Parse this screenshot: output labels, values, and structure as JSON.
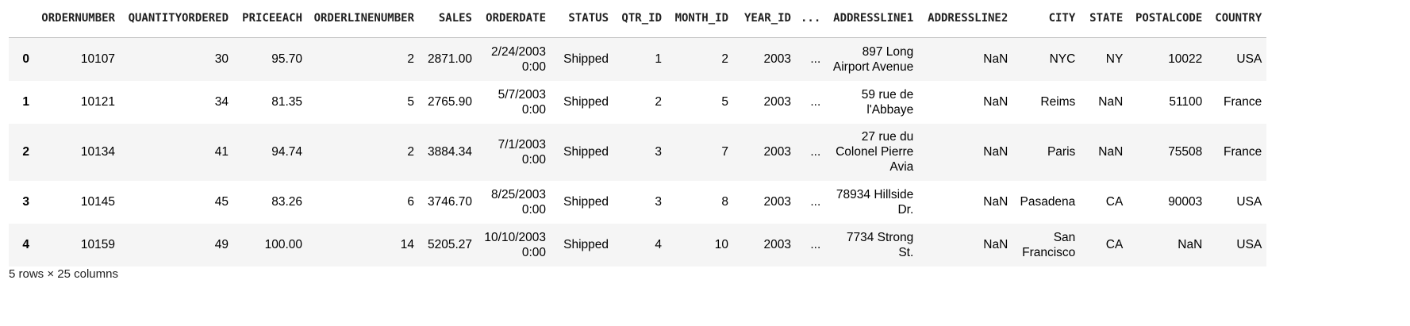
{
  "table": {
    "columns": [
      "",
      "ORDERNUMBER",
      "QUANTITYORDERED",
      "PRICEEACH",
      "ORDERLINENUMBER",
      "SALES",
      "ORDERDATE",
      "STATUS",
      "QTR_ID",
      "MONTH_ID",
      "YEAR_ID",
      "...",
      "ADDRESSLINE1",
      "ADDRESSLINE2",
      "CITY",
      "STATE",
      "POSTALCODE",
      "COUNTRY"
    ],
    "rows": [
      [
        "0",
        "10107",
        "30",
        "95.70",
        "2",
        "2871.00",
        "2/24/2003 0:00",
        "Shipped",
        "1",
        "2",
        "2003",
        "...",
        "897 Long Airport Avenue",
        "NaN",
        "NYC",
        "NY",
        "10022",
        "USA"
      ],
      [
        "1",
        "10121",
        "34",
        "81.35",
        "5",
        "2765.90",
        "5/7/2003 0:00",
        "Shipped",
        "2",
        "5",
        "2003",
        "...",
        "59 rue de l'Abbaye",
        "NaN",
        "Reims",
        "NaN",
        "51100",
        "France"
      ],
      [
        "2",
        "10134",
        "41",
        "94.74",
        "2",
        "3884.34",
        "7/1/2003 0:00",
        "Shipped",
        "3",
        "7",
        "2003",
        "...",
        "27 rue du Colonel Pierre Avia",
        "NaN",
        "Paris",
        "NaN",
        "75508",
        "France"
      ],
      [
        "3",
        "10145",
        "45",
        "83.26",
        "6",
        "3746.70",
        "8/25/2003 0:00",
        "Shipped",
        "3",
        "8",
        "2003",
        "...",
        "78934 Hillside Dr.",
        "NaN",
        "Pasadena",
        "CA",
        "90003",
        "USA"
      ],
      [
        "4",
        "10159",
        "49",
        "100.00",
        "14",
        "5205.27",
        "10/10/2003 0:00",
        "Shipped",
        "4",
        "10",
        "2003",
        "...",
        "7734 Strong St.",
        "NaN",
        "San Francisco",
        "CA",
        "NaN",
        "USA"
      ]
    ]
  },
  "footer": "5 rows × 25 columns"
}
